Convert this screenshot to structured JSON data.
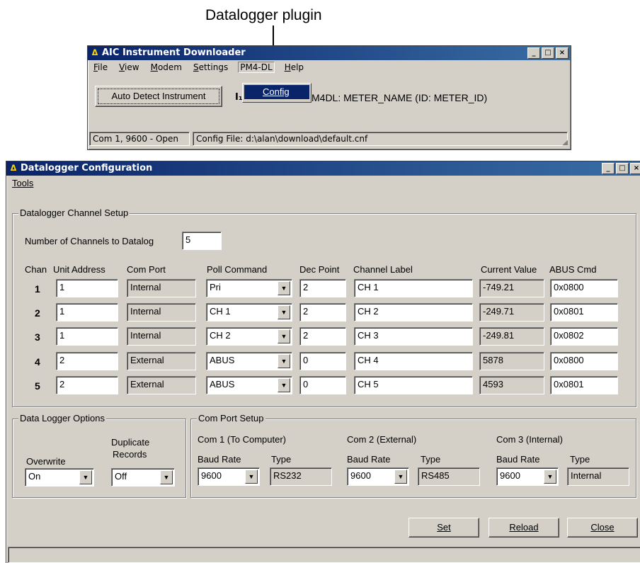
{
  "caption": "Datalogger plugin",
  "downloader": {
    "title": "AIC Instrument Downloader",
    "menu": [
      "File",
      "View",
      "Modem",
      "Settings",
      "PM4-DL",
      "Help"
    ],
    "popup_item": "Config",
    "auto_detect_label": "Auto Detect Instrument",
    "meter_text": "M4DL: METER_NAME (ID: METER_ID)",
    "status_left": "Com 1, 9600 - Open",
    "status_right": "Config File: d:\\alan\\download\\default.cnf"
  },
  "config": {
    "title": "Datalogger Configuration",
    "menu_tools": "Tools",
    "channel_group": "Datalogger Channel Setup",
    "num_channels_label": "Number of Channels to Datalog",
    "num_channels_value": "5",
    "headers": [
      "Chan",
      "Unit Address",
      "Com Port",
      "Poll Command",
      "Dec Point",
      "Channel Label",
      "Current Value",
      "ABUS Cmd"
    ],
    "rows": [
      {
        "chan": "1",
        "unit": "1",
        "port": "Internal",
        "poll": "Pri",
        "dec": "2",
        "label": "CH 1",
        "current": "-749.21",
        "abus": "0x0800"
      },
      {
        "chan": "2",
        "unit": "1",
        "port": "Internal",
        "poll": "CH 1",
        "dec": "2",
        "label": "CH 2",
        "current": "-249.71",
        "abus": "0x0801"
      },
      {
        "chan": "3",
        "unit": "1",
        "port": "Internal",
        "poll": "CH 2",
        "dec": "2",
        "label": "CH 3",
        "current": "-249.81",
        "abus": "0x0802"
      },
      {
        "chan": "4",
        "unit": "2",
        "port": "External",
        "poll": "ABUS",
        "dec": "0",
        "label": "CH 4",
        "current": "5878",
        "abus": "0x0800"
      },
      {
        "chan": "5",
        "unit": "2",
        "port": "External",
        "poll": "ABUS",
        "dec": "0",
        "label": "CH 5",
        "current": "4593",
        "abus": "0x0801"
      }
    ],
    "options_group": "Data Logger Options",
    "overwrite_label": "Overwrite",
    "overwrite_value": "On",
    "duplicate_label_1": "Duplicate",
    "duplicate_label_2": "Records",
    "duplicate_value": "Off",
    "comport_group": "Com Port Setup",
    "com1_title": "Com 1 (To Computer)",
    "com2_title": "Com 2 (External)",
    "com3_title": "Com 3 (Internal)",
    "baud_label": "Baud Rate",
    "type_label": "Type",
    "com1_baud": "9600",
    "com1_type": "RS232",
    "com2_baud": "9600",
    "com2_type": "RS485",
    "com3_baud": "9600",
    "com3_type": "Internal",
    "set_label": "Set",
    "reload_label": "Reload",
    "close_label": "Close"
  }
}
